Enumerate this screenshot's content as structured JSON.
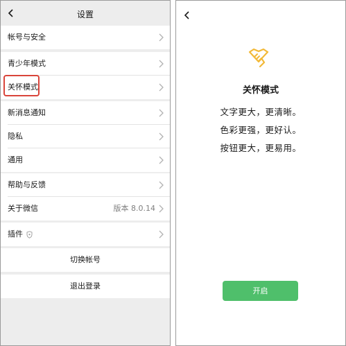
{
  "settings": {
    "title": "设置",
    "items": [
      {
        "label": "帐号与安全"
      },
      {
        "label": "青少年模式"
      },
      {
        "label": "关怀模式"
      },
      {
        "label": "新消息通知"
      },
      {
        "label": "隐私"
      },
      {
        "label": "通用"
      },
      {
        "label": "帮助与反馈"
      },
      {
        "label": "关于微信",
        "value": "版本 8.0.14"
      },
      {
        "label": "插件"
      }
    ],
    "switch_account": "切换帐号",
    "logout": "退出登录"
  },
  "care_mode": {
    "title": "关怀模式",
    "lines": [
      "文字更大，更清晰。",
      "色彩更强，更好认。",
      "按钮更大，更易用。"
    ],
    "open_button": "开启",
    "accent_color": "#4fbf6b",
    "icon_color": "#f2b938"
  },
  "icons": {
    "back": "chevron-left-icon",
    "row_arrow": "chevron-right-icon",
    "plugin": "shield-icon",
    "care": "heart-hand-icon"
  },
  "highlight_color": "#d9443a"
}
